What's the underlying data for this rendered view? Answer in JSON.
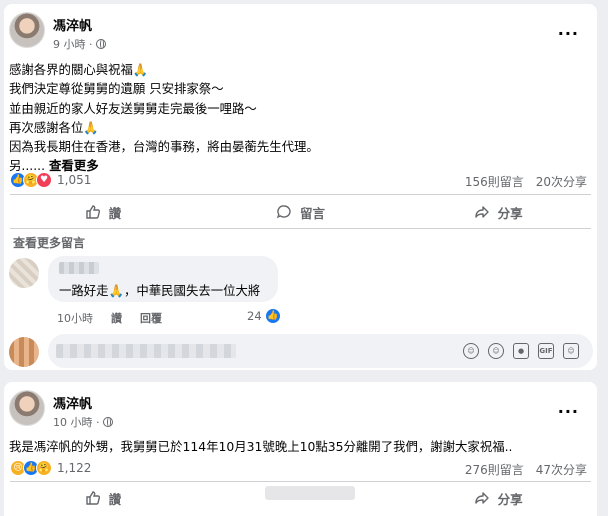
{
  "post1": {
    "author": "馮淬帆",
    "time": "9 小時",
    "lines": [
      "感謝各界的關心與祝福🙏",
      "我們決定尊從舅舅的遺願 只安排家祭～",
      "並由親近的家人好友送舅舅走完最後一哩路～",
      "再次感謝各位🙏",
      "因為我長期住在香港，台灣的事務，將由晏蘅先生代理。"
    ],
    "truncated_line": "另......",
    "see_more": "查看更多",
    "reactions_count": "1,051",
    "comments_count": "156則留言",
    "shares_count": "20次分享",
    "actions": {
      "like": "讚",
      "comment": "留言",
      "share": "分享"
    },
    "see_more_comments": "查看更多留言",
    "top_comment": {
      "text": "一路好走🙏，中華民國失去一位大將",
      "time": "10小時",
      "like": "讚",
      "reply": "回覆",
      "likes": "24"
    }
  },
  "post2": {
    "author": "馮淬帆",
    "time": "10 小時",
    "text": "我是馮淬帆的外甥，我舅舅已於114年10月31號晚上10點35分離開了我們，謝謝大家祝福..",
    "reactions_count": "1,122",
    "comments_count": "276則留言",
    "shares_count": "47次分享",
    "actions": {
      "like": "讚",
      "share": "分享"
    }
  },
  "icons": [
    "more-icon",
    "globe-icon",
    "like-icon",
    "comment-icon",
    "share-icon",
    "emoji-icon",
    "camera-icon",
    "gif-icon",
    "sticker-icon"
  ],
  "colors": {
    "like_blue": "#1877f2",
    "love_red": "#f33e58",
    "care_yellow": "#f7b125",
    "muted": "#65676b"
  }
}
